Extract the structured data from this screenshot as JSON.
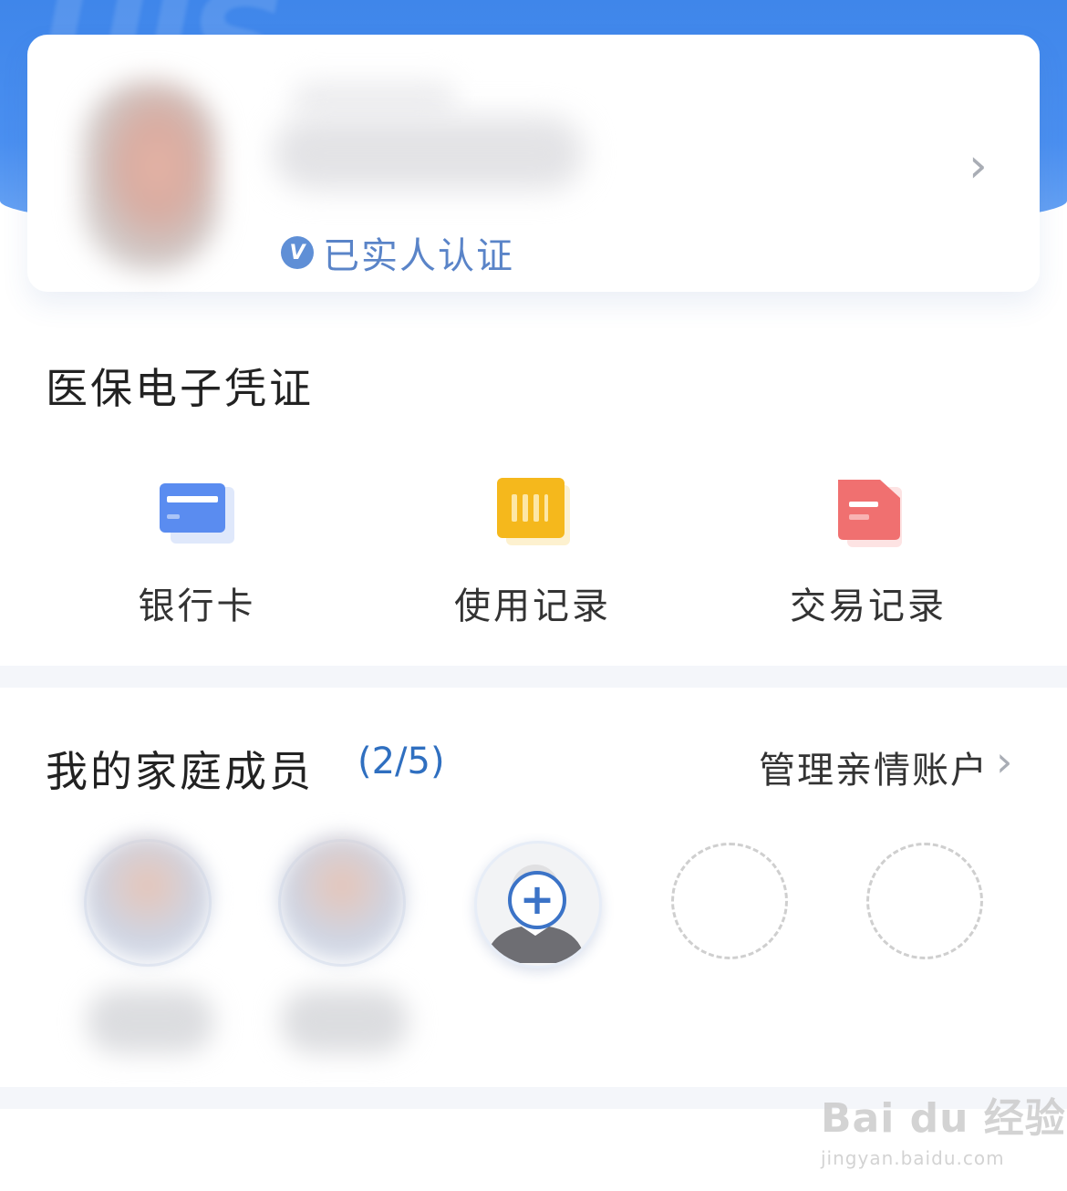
{
  "profile": {
    "verified_badge": "V",
    "verified_text": "已实人认证",
    "chevron": "›"
  },
  "voucher_section": {
    "title": "医保电子凭证",
    "items": [
      {
        "label": "银行卡",
        "icon": "bank-card-icon",
        "color": "#5a8cf0"
      },
      {
        "label": "使用记录",
        "icon": "usage-record-icon",
        "color": "#f5b81c"
      },
      {
        "label": "交易记录",
        "icon": "transaction-record-icon",
        "color": "#f07070"
      }
    ]
  },
  "family_section": {
    "title": "我的家庭成员",
    "count": "(2/5)",
    "manage_label": "管理亲情账户",
    "chevron": "›",
    "add_symbol": "+"
  },
  "watermark": {
    "main": "Bai du 经验",
    "sub": "jingyan.baidu.com"
  }
}
